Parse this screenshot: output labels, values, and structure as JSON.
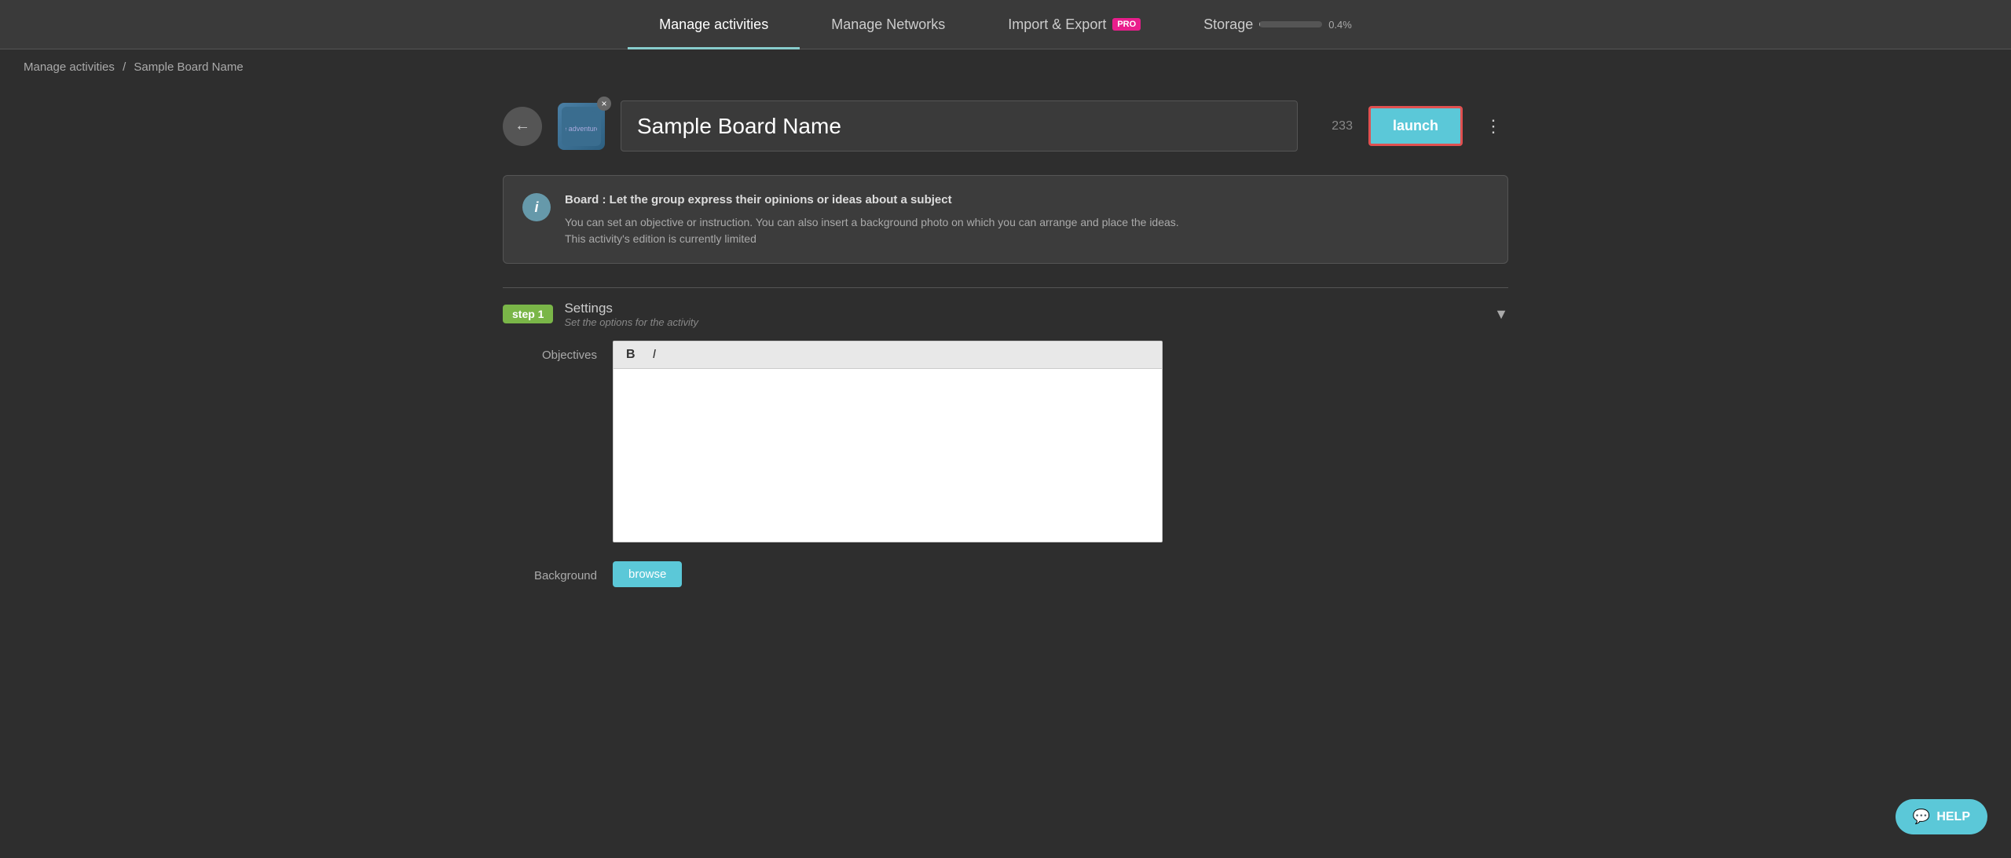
{
  "nav": {
    "items": [
      {
        "id": "manage-activities",
        "label": "Manage activities",
        "active": true
      },
      {
        "id": "manage-networks",
        "label": "Manage Networks",
        "active": false
      },
      {
        "id": "import-export",
        "label": "Import & Export",
        "active": false,
        "badge": "PRO"
      },
      {
        "id": "storage",
        "label": "Storage",
        "active": false,
        "storage_pct": "0.4%"
      }
    ]
  },
  "breadcrumb": {
    "root": "Manage activities",
    "separator": "/",
    "current": "Sample Board Name"
  },
  "board": {
    "title": "Sample Board Name",
    "count": "233",
    "back_label": "←",
    "close_label": "×",
    "launch_label": "launch",
    "more_label": "⋮"
  },
  "info": {
    "icon": "i",
    "title": "Board : Let the group express their opinions or ideas about a subject",
    "lines": [
      "You can set an objective or instruction. You can also insert a background photo on which you can arrange and place the ideas.",
      "This activity's edition is currently limited"
    ]
  },
  "step1": {
    "badge": "step 1",
    "title": "Settings",
    "subtitle": "Set the options for the activity"
  },
  "objectives": {
    "label": "Objectives",
    "toolbar": {
      "bold_label": "B",
      "italic_label": "I"
    },
    "placeholder": ""
  },
  "background": {
    "label": "Background",
    "browse_label": "browse"
  },
  "help": {
    "icon": "💬",
    "label": "HELP"
  },
  "colors": {
    "accent_cyan": "#5bc8d8",
    "accent_green": "#7ab648",
    "accent_pink": "#e91e8c",
    "launch_border": "#e05050",
    "nav_bg": "#3a3a3a",
    "body_bg": "#2e2e2e"
  }
}
